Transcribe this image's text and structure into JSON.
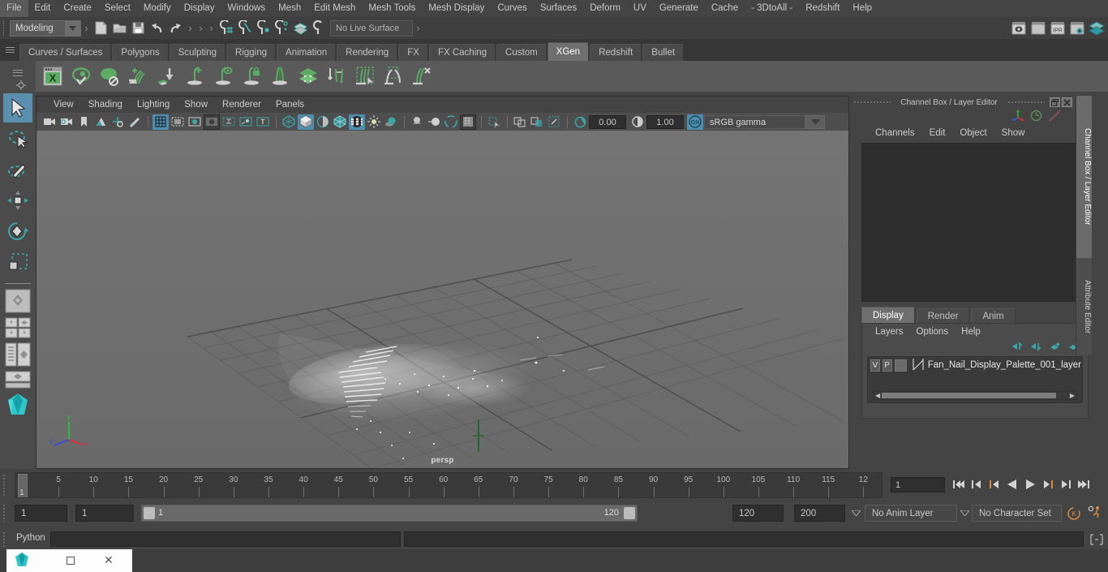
{
  "menu": {
    "items": [
      "File",
      "Edit",
      "Create",
      "Select",
      "Modify",
      "Display",
      "Windows",
      "Mesh",
      "Edit Mesh",
      "Mesh Tools",
      "Mesh Display",
      "Curves",
      "Surfaces",
      "Deform",
      "UV",
      "Generate",
      "Cache",
      "- 3DtoAll -",
      "Redshift",
      "Help"
    ]
  },
  "statusline": {
    "mode": "Modeling",
    "live_surface": "No Live Surface",
    "file_icons": [
      "new-scene-icon",
      "open-scene-icon",
      "save-scene-icon",
      "undo-icon",
      "redo-icon"
    ],
    "snap_icons": [
      "snap-to-grid-icon",
      "snap-to-curve-icon",
      "snap-to-point-icon",
      "snap-to-projected-center-icon",
      "snap-to-view-plane-icon",
      "make-live-icon"
    ],
    "render_icons": [
      "render-current-frame-icon",
      "render-sequence-icon",
      "ipr-render-icon",
      "render-settings-icon",
      "hypershade-icon"
    ],
    "right_icons": [
      "show-hide-modeling-toolkit-icon",
      "show-hide-attribute-editor-icon",
      "show-hide-tool-settings-icon",
      "show-hide-channel-box-icon"
    ]
  },
  "shelf": {
    "tabs": [
      "Curves / Surfaces",
      "Polygons",
      "Sculpting",
      "Rigging",
      "Animation",
      "Rendering",
      "FX",
      "FX Caching",
      "Custom",
      "XGen",
      "Redshift",
      "Bullet"
    ],
    "active_tab": "XGen",
    "icons": [
      "xgen-window-icon",
      "xgen-preview-visible-icon",
      "xgen-preview-off-icon",
      "xgen-add-groom-icon",
      "xgen-import-collection-icon",
      "xgen-create-description-icon",
      "xgen-preview-description-icon",
      "xgen-lock-description-icon",
      "xgen-clone-description-icon",
      "xgen-patch-layers-icon",
      "xgen-convert-to-interactive-icon",
      "xgen-select-guides-icon",
      "xgen-groom-density-icon",
      "xgen-delete-guides-icon"
    ]
  },
  "toolbox": {
    "tools": [
      "select-tool-icon",
      "lasso-select-tool-icon",
      "paint-select-tool-icon",
      "move-tool-icon",
      "rotate-tool-icon",
      "scale-tool-icon"
    ],
    "active_tool": "select-tool-icon",
    "layouts": [
      "single-pane-layout-icon",
      "four-pane-layout-icon",
      "outliner-persp-layout-icon",
      "persp-graph-layout-icon",
      "maya-logo-icon"
    ]
  },
  "viewport": {
    "menu": [
      "View",
      "Shading",
      "Lighting",
      "Show",
      "Renderer",
      "Panels"
    ],
    "camera_label": "persp",
    "toolbar": {
      "exposure": "0.00",
      "gamma_value": "1.00",
      "color_management": "sRGB gamma",
      "icons": [
        "select-camera-icon",
        "camera-attributes-icon",
        "bookmark-icon",
        "image-plane-icon",
        "two-d-pan-zoom-icon",
        "grease-pencil-icon",
        "grid-toggle-icon",
        "film-gate-icon",
        "resolution-gate-icon",
        "gate-mask-icon",
        "field-chart-icon",
        "safe-action-icon",
        "safe-title-icon",
        "wireframe-shading-icon",
        "smooth-shade-all-icon",
        "shade-selected-items-icon",
        "wireframe-on-shaded-icon",
        "texture-toggle-icon",
        "use-all-lights-icon",
        "shadows-icon",
        "screen-space-ao-icon",
        "motion-blur-icon",
        "multisample-aa-icon",
        "isolate-select-icon",
        "xray-toggle-icon",
        "xray-joints-icon",
        "xray-active-components-icon",
        "exposure-icon",
        "gamma-icon",
        "color-management-on-icon"
      ]
    },
    "axis_labels": {
      "x": "x",
      "y": "y",
      "z": "z"
    }
  },
  "right_panel": {
    "title": "Channel Box / Layer Editor",
    "titlebar_buttons": [
      "undock-icon",
      "close-icon"
    ],
    "header_icons": [
      "manipulator-axis-icon",
      "clock-icon",
      "curve-icon"
    ],
    "channel_menu": [
      "Channels",
      "Edit",
      "Object",
      "Show"
    ],
    "layer_tabs": [
      "Display",
      "Render",
      "Anim"
    ],
    "active_layer_tab": "Display",
    "layer_menu": [
      "Layers",
      "Options",
      "Help"
    ],
    "layer_buttons": [
      "move-layer-up-icon",
      "move-layer-down-icon",
      "create-new-layer-icon",
      "create-layer-from-selected-icon"
    ],
    "layers": [
      {
        "visibility": "V",
        "playback": "P",
        "shading": "",
        "name": "Fan_Nail_Display_Palette_001_layer"
      }
    ],
    "vertical_tabs": [
      "Channel Box / Layer Editor",
      "Attribute Editor"
    ],
    "active_vertical_tab": "Channel Box / Layer Editor"
  },
  "time_slider": {
    "current_frame_marker": "1",
    "current_frame_field": "1",
    "tick_labels": [
      "5",
      "10",
      "15",
      "20",
      "25",
      "30",
      "35",
      "40",
      "45",
      "50",
      "55",
      "60",
      "65",
      "70",
      "75",
      "80",
      "85",
      "90",
      "95",
      "100",
      "105",
      "110",
      "115",
      "12"
    ],
    "playback_buttons": [
      "go-to-start-icon",
      "step-back-keyframe-icon",
      "step-back-frame-icon",
      "play-backwards-icon",
      "play-forwards-icon",
      "step-forward-frame-icon",
      "step-forward-keyframe-icon",
      "go-to-end-icon"
    ]
  },
  "range_slider": {
    "anim_start": "1",
    "range_start": "1",
    "bar_start": "1",
    "bar_end": "120",
    "range_end": "120",
    "anim_end": "200",
    "anim_layer": "No Anim Layer",
    "character_set": "No Character Set",
    "right_icons": [
      "auto-keyframe-toggle-icon",
      "animation-preferences-icon"
    ]
  },
  "command_line": {
    "language": "Python",
    "input_value": "",
    "output_value": "",
    "help_icon": "script-editor-icon"
  },
  "taskbar": {
    "window_icon": "maya-app-icon",
    "buttons": [
      "restore-icon",
      "close-icon"
    ]
  },
  "colors": {
    "accent_blue": "#4e8fb0",
    "xgen_green": "#5bab62",
    "orange": "#d98b45",
    "panel_bg": "#444444",
    "field_bg": "#2f2f2f"
  }
}
